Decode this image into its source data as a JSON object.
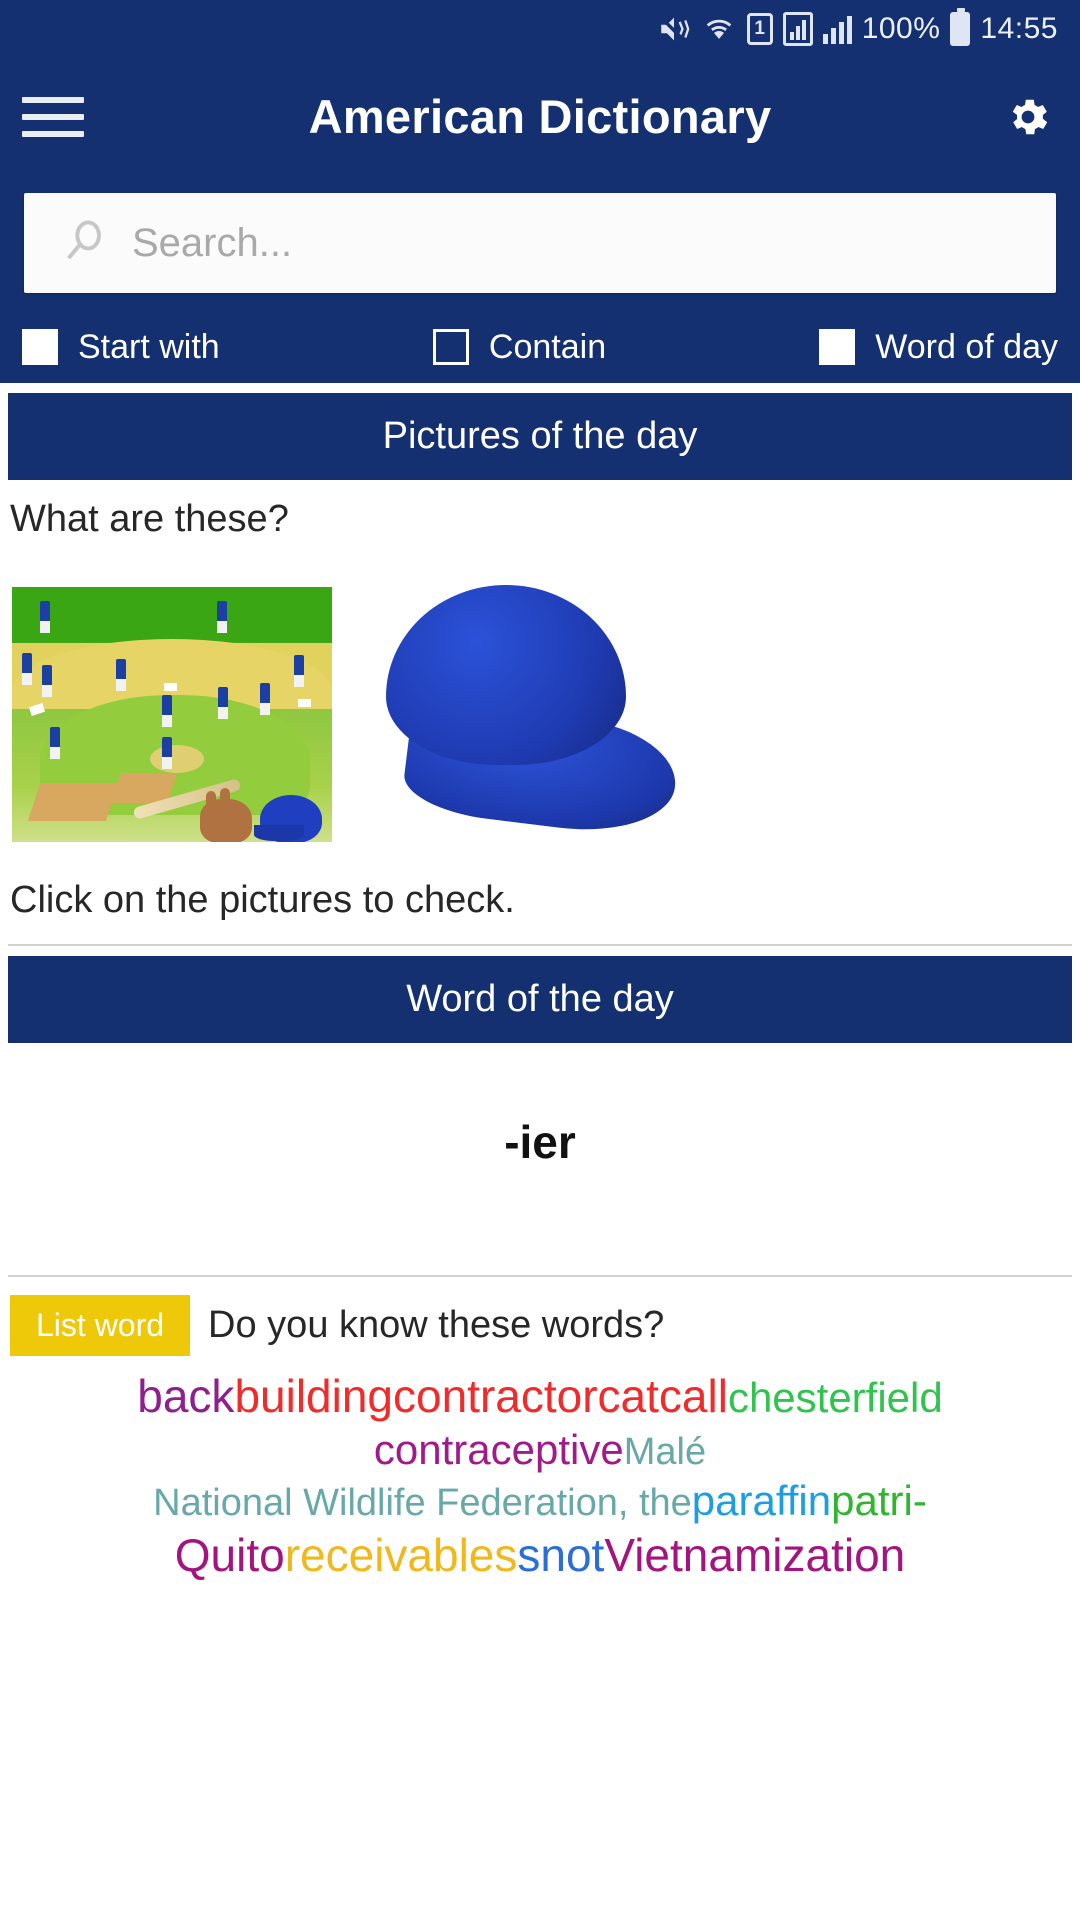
{
  "statusbar": {
    "sim_label": "1",
    "battery_percent": "100%",
    "time": "14:55",
    "icons": [
      "mute-vibrate-icon",
      "wifi-icon",
      "sim1-icon",
      "signal-icon",
      "signal-bars-icon",
      "battery-icon"
    ]
  },
  "appbar": {
    "title": "American Dictionary",
    "menu_icon": "hamburger-icon",
    "settings_icon": "gear-icon"
  },
  "search": {
    "placeholder": "Search...",
    "value": "",
    "icon": "search-icon"
  },
  "options": [
    {
      "label": "Start with",
      "checked": true
    },
    {
      "label": "Contain",
      "checked": false
    },
    {
      "label": "Word of day",
      "checked": true
    }
  ],
  "pictures_section": {
    "header": "Pictures of the day",
    "question": "What are these?",
    "note": "Click on the pictures to check.",
    "images": [
      {
        "name": "baseball-field-picture",
        "alt": "baseball diamond with players, bat, glove and helmet"
      },
      {
        "name": "blue-cap-picture",
        "alt": "blue baseball cap"
      }
    ]
  },
  "word_of_day": {
    "header": "Word of the day",
    "word": "-ier"
  },
  "list_word": {
    "badge": "List word",
    "question": "Do you know these words?",
    "words": [
      {
        "text": "back",
        "color": "#8e1f8e"
      },
      {
        "text": "building",
        "color": "#f02b2b"
      },
      {
        "text": "contractor",
        "color": "#f02b2b"
      },
      {
        "text": "catcall",
        "color": "#f02b2b"
      },
      {
        "text": "chesterfield",
        "color": "#2fc34f"
      },
      {
        "text": "contraceptive",
        "color": "#a01a8a"
      },
      {
        "text": "Malé",
        "color": "#69a8a8"
      },
      {
        "text": "National Wildlife Federation, the",
        "color": "#69a8a8"
      },
      {
        "text": "paraffin",
        "color": "#1c9ee0"
      },
      {
        "text": "patri-",
        "color": "#2fb52f"
      },
      {
        "text": "Quito",
        "color": "#a3147e"
      },
      {
        "text": "receivables",
        "color": "#f0b81a"
      },
      {
        "text": "snot",
        "color": "#2a6ed6"
      },
      {
        "text": "Vietnamization",
        "color": "#a3147e"
      }
    ],
    "line_sizes": [
      46,
      42,
      42,
      46
    ]
  },
  "colors": {
    "brand_blue": "#143070",
    "badge_yellow": "#eec90a",
    "page_bg": "#ffffff"
  }
}
